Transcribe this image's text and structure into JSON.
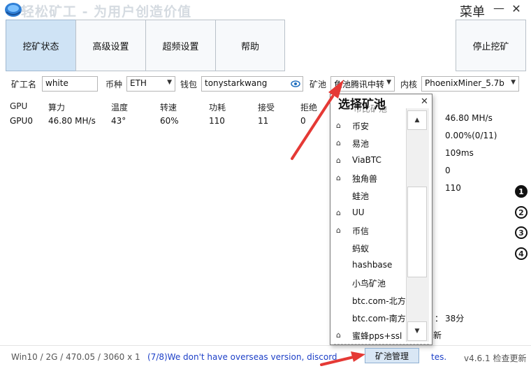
{
  "window": {
    "title": "轻松矿工 - 为用户创造价值",
    "menu_label": "菜单",
    "minimize": "—",
    "close": "✕"
  },
  "nav": {
    "tabs": [
      {
        "label": "挖矿状态",
        "active": true
      },
      {
        "label": "高级设置"
      },
      {
        "label": "超频设置"
      },
      {
        "label": "帮助"
      }
    ],
    "stop_label": "停止挖矿"
  },
  "settings": {
    "worker_label": "矿工名",
    "worker_value": "white",
    "coin_label": "币种",
    "coin_value": "ETH",
    "wallet_label": "钱包",
    "wallet_value": "tonystarkwang",
    "pool_label": "矿池",
    "pool_value": "鱼池腾讯中转",
    "kernel_label": "内核",
    "kernel_value": "PhoenixMiner_5.7b"
  },
  "gpu_table": {
    "headers": [
      "GPU",
      "算力",
      "温度",
      "转速",
      "功耗",
      "接受",
      "拒绝"
    ],
    "rows": [
      [
        "GPU0",
        "46.80 MH/s",
        "43°",
        "60%",
        "110",
        "11",
        "0"
      ]
    ]
  },
  "stats": {
    "hashrate": "46.80 MH/s",
    "reject_rate": "0.00%(0/11)",
    "latency": "109ms",
    "value4": "0",
    "power": "110",
    "elapsed": "38分",
    "partial_left": "：",
    "partial_refresh": "新"
  },
  "side_numbers": [
    "1",
    "2",
    "3",
    "4"
  ],
  "pool_popup": {
    "title": "选择矿池",
    "clipped_top": "币比矿池",
    "items": [
      {
        "label": "币安",
        "home": true
      },
      {
        "label": "易池",
        "home": true
      },
      {
        "label": "ViaBTC",
        "home": true
      },
      {
        "label": "独角兽",
        "home": true
      },
      {
        "label": "蛙池",
        "home": false
      },
      {
        "label": "UU",
        "home": true
      },
      {
        "label": "币信",
        "home": true
      },
      {
        "label": "蚂蚁",
        "home": false
      },
      {
        "label": "hashbase",
        "home": false
      },
      {
        "label": "小鸟矿池",
        "home": false
      },
      {
        "label": "btc.com-北方",
        "home": false
      },
      {
        "label": "btc.com-南方",
        "home": false
      },
      {
        "label": "蜜蜂pps+ssl",
        "home": true
      }
    ],
    "manage_button": "矿池管理",
    "close": "✕"
  },
  "statusbar": {
    "system_info": "Win10  / 2G / 470.05 / 3060 x 1",
    "message": "(7/8)We don't have overseas version, discord",
    "message_end": "tes.",
    "version": "v4.6.1 检查更新"
  },
  "colors": {
    "active_tab": "#cfe3f5",
    "status_message": "#1c3fc7",
    "annotation_arrow": "#e53935"
  }
}
